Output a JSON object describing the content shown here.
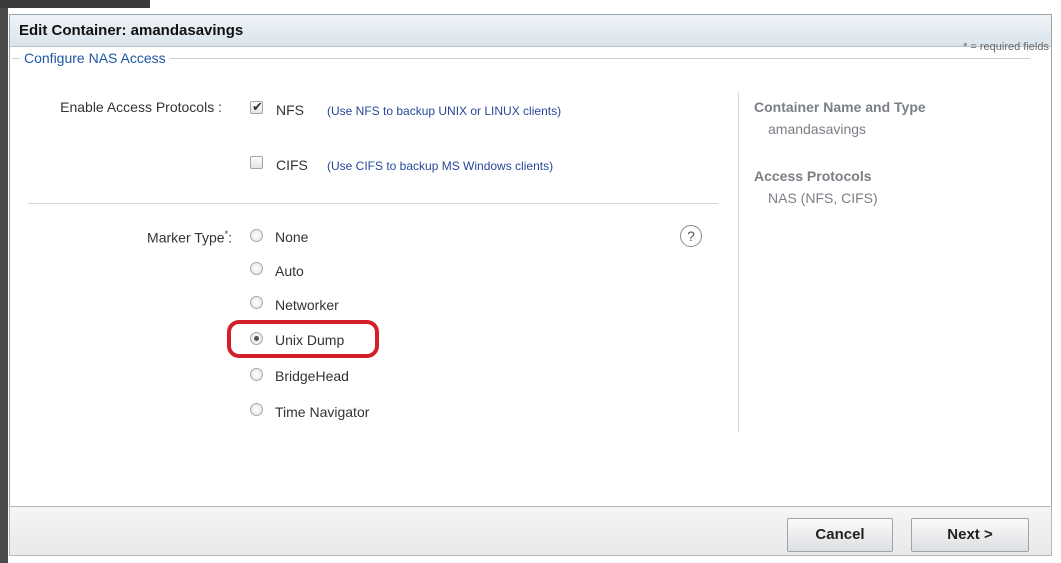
{
  "dialog": {
    "title": "Edit Container: amandasavings",
    "required_note": "* = required fields"
  },
  "section": {
    "legend": "Configure NAS Access"
  },
  "protocols": {
    "label": "Enable Access Protocols :",
    "options": [
      {
        "name": "NFS",
        "hint": "(Use NFS to backup UNIX or LINUX clients)",
        "checked": true
      },
      {
        "name": "CIFS",
        "hint": "(Use CIFS to backup MS Windows clients)",
        "checked": false
      }
    ]
  },
  "marker": {
    "label": "Marker Type",
    "required_mark": "*",
    "suffix": ":",
    "help_icon": "?",
    "selected": "Unix Dump",
    "options": [
      "None",
      "Auto",
      "Networker",
      "Unix Dump",
      "BridgeHead",
      "Time Navigator"
    ]
  },
  "summary": {
    "container_heading": "Container Name and Type",
    "container_value": "amandasavings",
    "protocols_heading": "Access Protocols",
    "protocols_value": "NAS (NFS, CIFS)"
  },
  "footer": {
    "cancel_label": "Cancel",
    "next_label": "Next >"
  },
  "colors": {
    "legend": "#1f56a5",
    "hint": "#27489b",
    "highlight": "#d21f2a"
  }
}
